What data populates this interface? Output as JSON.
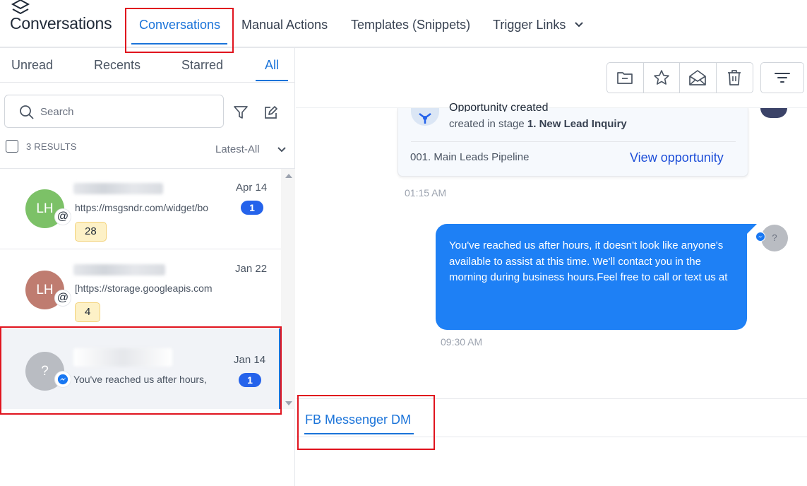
{
  "header": {
    "app_title": "Conversations",
    "tabs": [
      {
        "label": "Conversations"
      },
      {
        "label": "Manual Actions"
      },
      {
        "label": "Templates (Snippets)"
      },
      {
        "label": "Trigger Links"
      }
    ]
  },
  "filters": {
    "tabs": [
      {
        "label": "Unread"
      },
      {
        "label": "Recents"
      },
      {
        "label": "Starred"
      },
      {
        "label": "All"
      }
    ]
  },
  "search": {
    "placeholder": "Search",
    "value": ""
  },
  "results": {
    "label": "3 RESULTS",
    "sort": "Latest-All"
  },
  "conversations": [
    {
      "initials": "LH",
      "preview": "https://msgsndr.com/widget/bo",
      "date": "Apr 14",
      "unread": "1",
      "tag": "28",
      "avatar_color": "#7cc167",
      "channel": "email-icon"
    },
    {
      "initials": "LH",
      "preview": "[https://storage.googleapis.com",
      "date": "Jan 22",
      "unread": "",
      "tag": "4",
      "avatar_color": "#bf7c70",
      "channel": "email-icon"
    },
    {
      "initials": "?",
      "preview": "You've reached us after hours,",
      "date": "Jan 14",
      "unread": "1",
      "tag": "",
      "avatar_color": "#b9bcc2",
      "channel": "messenger-icon"
    }
  ],
  "opportunity": {
    "title": "Opportunity created",
    "sub_prefix": "created in stage ",
    "stage": "1. New Lead Inquiry",
    "pipeline": "001. Main Leads Pipeline",
    "link": "View opportunity"
  },
  "messages": [
    {
      "time": "01:15 AM"
    },
    {
      "text": "You've reached us after hours, it doesn't look like anyone's available to assist at this time. We'll contact you in the morning during business hours.Feel free to call or text us at",
      "time": "09:30 AM",
      "avatar": "?"
    }
  ],
  "compose": {
    "channel_tab": "FB Messenger DM"
  },
  "colors": {
    "accent": "#1a73d9",
    "bubble": "#1e80f5",
    "badge": "#2563eb",
    "highlight": "#e0141e"
  }
}
